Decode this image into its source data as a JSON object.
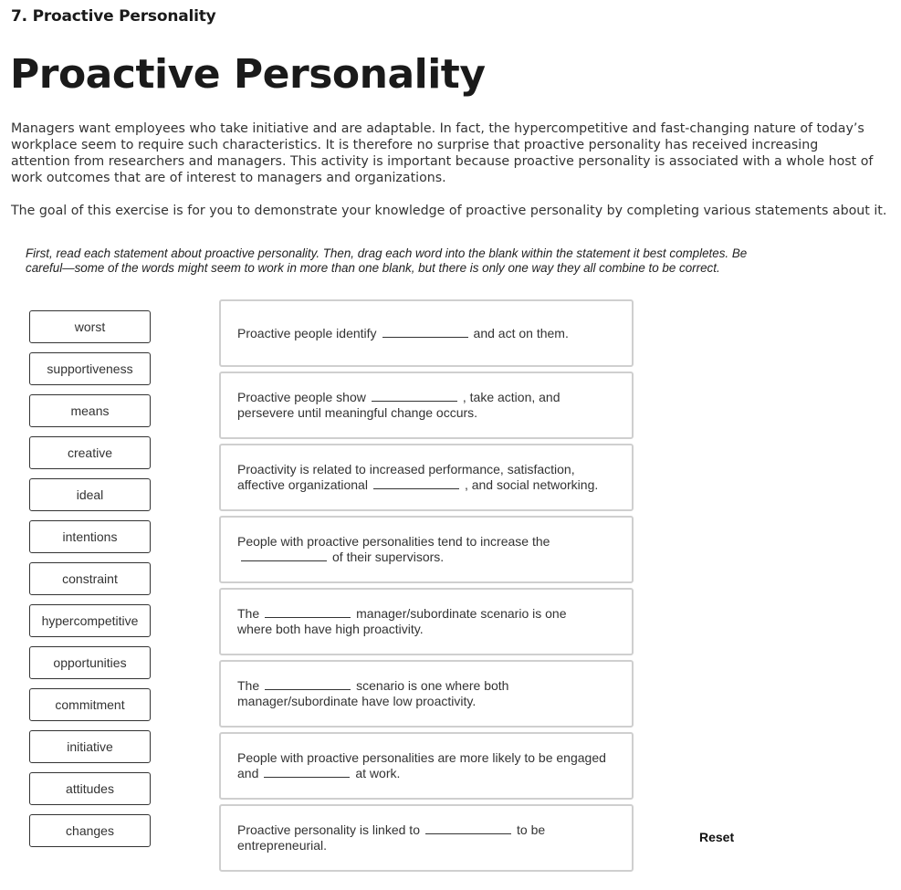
{
  "header": {
    "crumb_title": "7. Proactive Personality",
    "page_title": "Proactive Personality"
  },
  "intro": "Managers want employees who take initiative and are adaptable. In fact, the hypercompetitive and fast-changing nature of today’s workplace seem to require such characteristics. It is therefore no surprise that proactive personality has received increasing attention from researchers and managers. This activity is important because proactive personality is associated with a whole host of work outcomes that are of interest to managers and organizations.",
  "goal": "The goal of this exercise is for you to demonstrate your knowledge of proactive personality by completing various statements about it.",
  "instructions": "First, read each statement about proactive personality. Then, drag each word into the blank within the statement it best completes. Be careful—some of the words might seem to work in more than one blank, but there is only one way they all combine to be correct.",
  "word_bank": [
    "worst",
    "supportiveness",
    "means",
    "creative",
    "ideal",
    "intentions",
    "constraint",
    "hypercompetitive",
    "opportunities",
    "commitment",
    "initiative",
    "attitudes",
    "changes"
  ],
  "statements": [
    {
      "before": "Proactive people identify",
      "after": "and act on them."
    },
    {
      "before": "Proactive people show",
      "after": ", take action, and persevere until meaningful change occurs."
    },
    {
      "before": "Proactivity is related to increased performance, satisfaction, affective organizational",
      "after": ", and social networking."
    },
    {
      "before": "People with proactive personalities tend to increase the",
      "after": "of their supervisors."
    },
    {
      "before": "The",
      "after": "manager/subordinate scenario is one where both have high proactivity."
    },
    {
      "before": "The",
      "after": "scenario is one where both manager/subordinate have low proactivity."
    },
    {
      "before": "People with proactive personalities are more likely to be engaged and",
      "after": "at work."
    },
    {
      "before": "Proactive personality is linked to",
      "after": "to be entrepreneurial."
    }
  ],
  "reset_label": "Reset"
}
